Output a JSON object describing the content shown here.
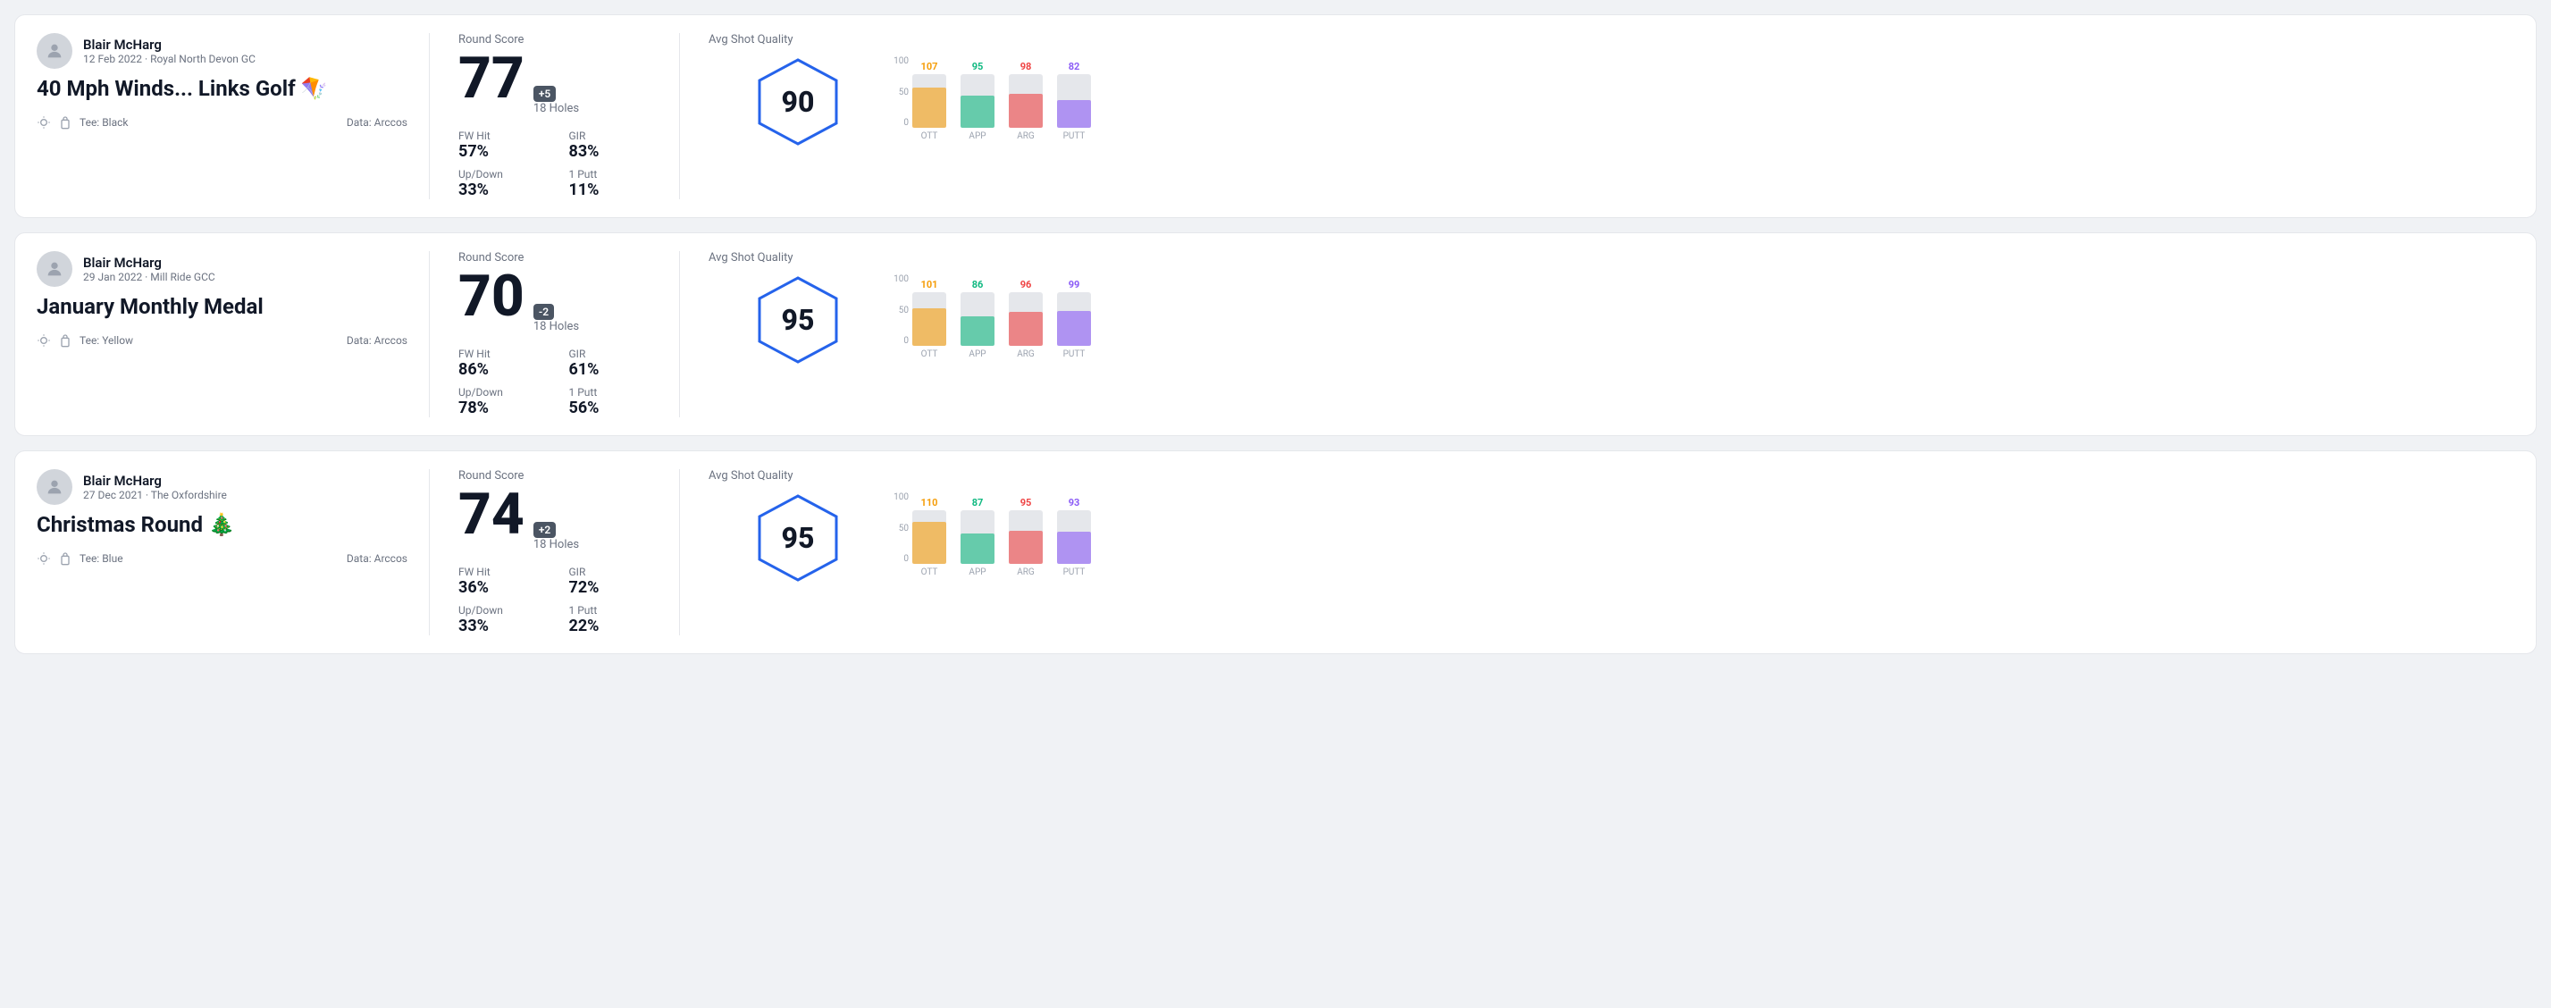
{
  "rounds": [
    {
      "id": "round1",
      "user": {
        "name": "Blair McHarg",
        "meta": "12 Feb 2022 · Royal North Devon GC"
      },
      "title": "40 Mph Winds... Links Golf 🪁",
      "tee": "Black",
      "data_source": "Data: Arccos",
      "score": {
        "label": "Round Score",
        "value": "77",
        "modifier": "+5",
        "holes": "18 Holes"
      },
      "stats": {
        "fw_hit_label": "FW Hit",
        "fw_hit_value": "57%",
        "gir_label": "GIR",
        "gir_value": "83%",
        "updown_label": "Up/Down",
        "updown_value": "33%",
        "oneputt_label": "1 Putt",
        "oneputt_value": "11%"
      },
      "avg_quality": {
        "label": "Avg Shot Quality",
        "value": "90"
      },
      "bars": [
        {
          "label": "OTT",
          "value": 107,
          "color": "#f59e0b",
          "bar_pct": 75
        },
        {
          "label": "APP",
          "value": 95,
          "color": "#10b981",
          "bar_pct": 60
        },
        {
          "label": "ARG",
          "value": 98,
          "color": "#ef4444",
          "bar_pct": 63
        },
        {
          "label": "PUTT",
          "value": 82,
          "color": "#8b5cf6",
          "bar_pct": 52
        }
      ]
    },
    {
      "id": "round2",
      "user": {
        "name": "Blair McHarg",
        "meta": "29 Jan 2022 · Mill Ride GCC"
      },
      "title": "January Monthly Medal",
      "tee": "Yellow",
      "data_source": "Data: Arccos",
      "score": {
        "label": "Round Score",
        "value": "70",
        "modifier": "-2",
        "holes": "18 Holes"
      },
      "stats": {
        "fw_hit_label": "FW Hit",
        "fw_hit_value": "86%",
        "gir_label": "GIR",
        "gir_value": "61%",
        "updown_label": "Up/Down",
        "updown_value": "78%",
        "oneputt_label": "1 Putt",
        "oneputt_value": "56%"
      },
      "avg_quality": {
        "label": "Avg Shot Quality",
        "value": "95"
      },
      "bars": [
        {
          "label": "OTT",
          "value": 101,
          "color": "#f59e0b",
          "bar_pct": 70
        },
        {
          "label": "APP",
          "value": 86,
          "color": "#10b981",
          "bar_pct": 55
        },
        {
          "label": "ARG",
          "value": 96,
          "color": "#ef4444",
          "bar_pct": 63
        },
        {
          "label": "PUTT",
          "value": 99,
          "color": "#8b5cf6",
          "bar_pct": 65
        }
      ]
    },
    {
      "id": "round3",
      "user": {
        "name": "Blair McHarg",
        "meta": "27 Dec 2021 · The Oxfordshire"
      },
      "title": "Christmas Round 🎄",
      "tee": "Blue",
      "data_source": "Data: Arccos",
      "score": {
        "label": "Round Score",
        "value": "74",
        "modifier": "+2",
        "holes": "18 Holes"
      },
      "stats": {
        "fw_hit_label": "FW Hit",
        "fw_hit_value": "36%",
        "gir_label": "GIR",
        "gir_value": "72%",
        "updown_label": "Up/Down",
        "updown_value": "33%",
        "oneputt_label": "1 Putt",
        "oneputt_value": "22%"
      },
      "avg_quality": {
        "label": "Avg Shot Quality",
        "value": "95"
      },
      "bars": [
        {
          "label": "OTT",
          "value": 110,
          "color": "#f59e0b",
          "bar_pct": 78
        },
        {
          "label": "APP",
          "value": 87,
          "color": "#10b981",
          "bar_pct": 56
        },
        {
          "label": "ARG",
          "value": 95,
          "color": "#ef4444",
          "bar_pct": 62
        },
        {
          "label": "PUTT",
          "value": 93,
          "color": "#8b5cf6",
          "bar_pct": 60
        }
      ]
    }
  ],
  "chart": {
    "y_labels": [
      "100",
      "50",
      "0"
    ]
  }
}
